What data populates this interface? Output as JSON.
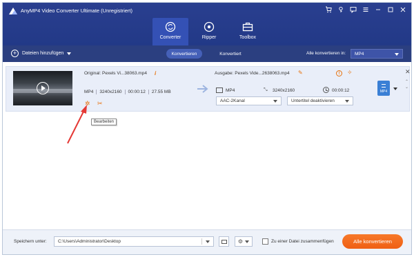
{
  "app": {
    "title": "AnyMP4 Video Converter Ultimate (Unregistriert)"
  },
  "tabs": [
    {
      "label": "Converter",
      "icon": "converter-icon",
      "active": true
    },
    {
      "label": "Ripper",
      "icon": "ripper-icon",
      "active": false
    },
    {
      "label": "Toolbox",
      "icon": "toolbox-icon",
      "active": false
    }
  ],
  "toolbar": {
    "add_files": "Dateien hinzufügen",
    "converting": "Konvertieren",
    "converted": "Konvertiert",
    "convert_all_to_label": "Alle konvertieren in:",
    "convert_all_to_value": "MP4"
  },
  "file": {
    "original": "Original: Pexels Vi...38063.mp4",
    "format": "MP4",
    "resolution": "3240x2160",
    "duration": "00:00:12",
    "size": "27.55 MB",
    "output": "Ausgabe: Pexels Vide...2638063.mp4",
    "out_format": "MP4",
    "out_resolution": "3240x2160",
    "out_duration": "00:00:12",
    "audio": "AAC-2Kanal",
    "subtitle": "Untertitel deaktivieren",
    "format_badge": "MP4"
  },
  "tooltip": "Bearbeiten",
  "footer": {
    "save_label": "Speichern unter:",
    "save_path": "C:\\Users\\Administrator\\Desktop",
    "merge_label": "Zu einer Datei zusammenfügen",
    "convert_all_button": "Alle konvertieren"
  },
  "colors": {
    "header": "#2a3f8f",
    "accent": "#e8710a",
    "convert_button": "#f46b1f",
    "row_bg": "#e9eef9"
  }
}
